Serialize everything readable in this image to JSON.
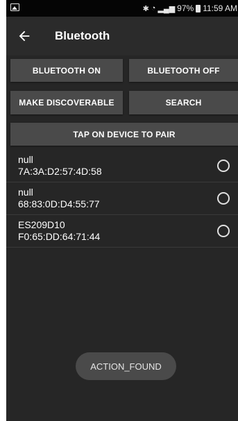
{
  "status_bar": {
    "battery": "97%",
    "time": "11:59 AM"
  },
  "app_bar": {
    "title": "Bluetooth"
  },
  "buttons": {
    "bluetooth_on": "BLUETOOTH ON",
    "bluetooth_off": "BLUETOOTH OFF",
    "make_discoverable": "MAKE DISCOVERABLE",
    "search": "SEARCH",
    "tap_to_pair": "TAP ON DEVICE TO PAIR"
  },
  "devices": [
    {
      "name": "null",
      "address": "7A:3A:D2:57:4D:58"
    },
    {
      "name": "null",
      "address": "68:83:0D:D4:55:77"
    },
    {
      "name": "ES209D10",
      "address": "F0:65:DD:64:71:44"
    }
  ],
  "toast": {
    "text": "ACTION_FOUND"
  },
  "colors": {
    "background": "#262626",
    "app_bar": "#2b2b2b",
    "button": "#4a4a4a",
    "status_bar": "#050505",
    "text": "#ffffff"
  }
}
